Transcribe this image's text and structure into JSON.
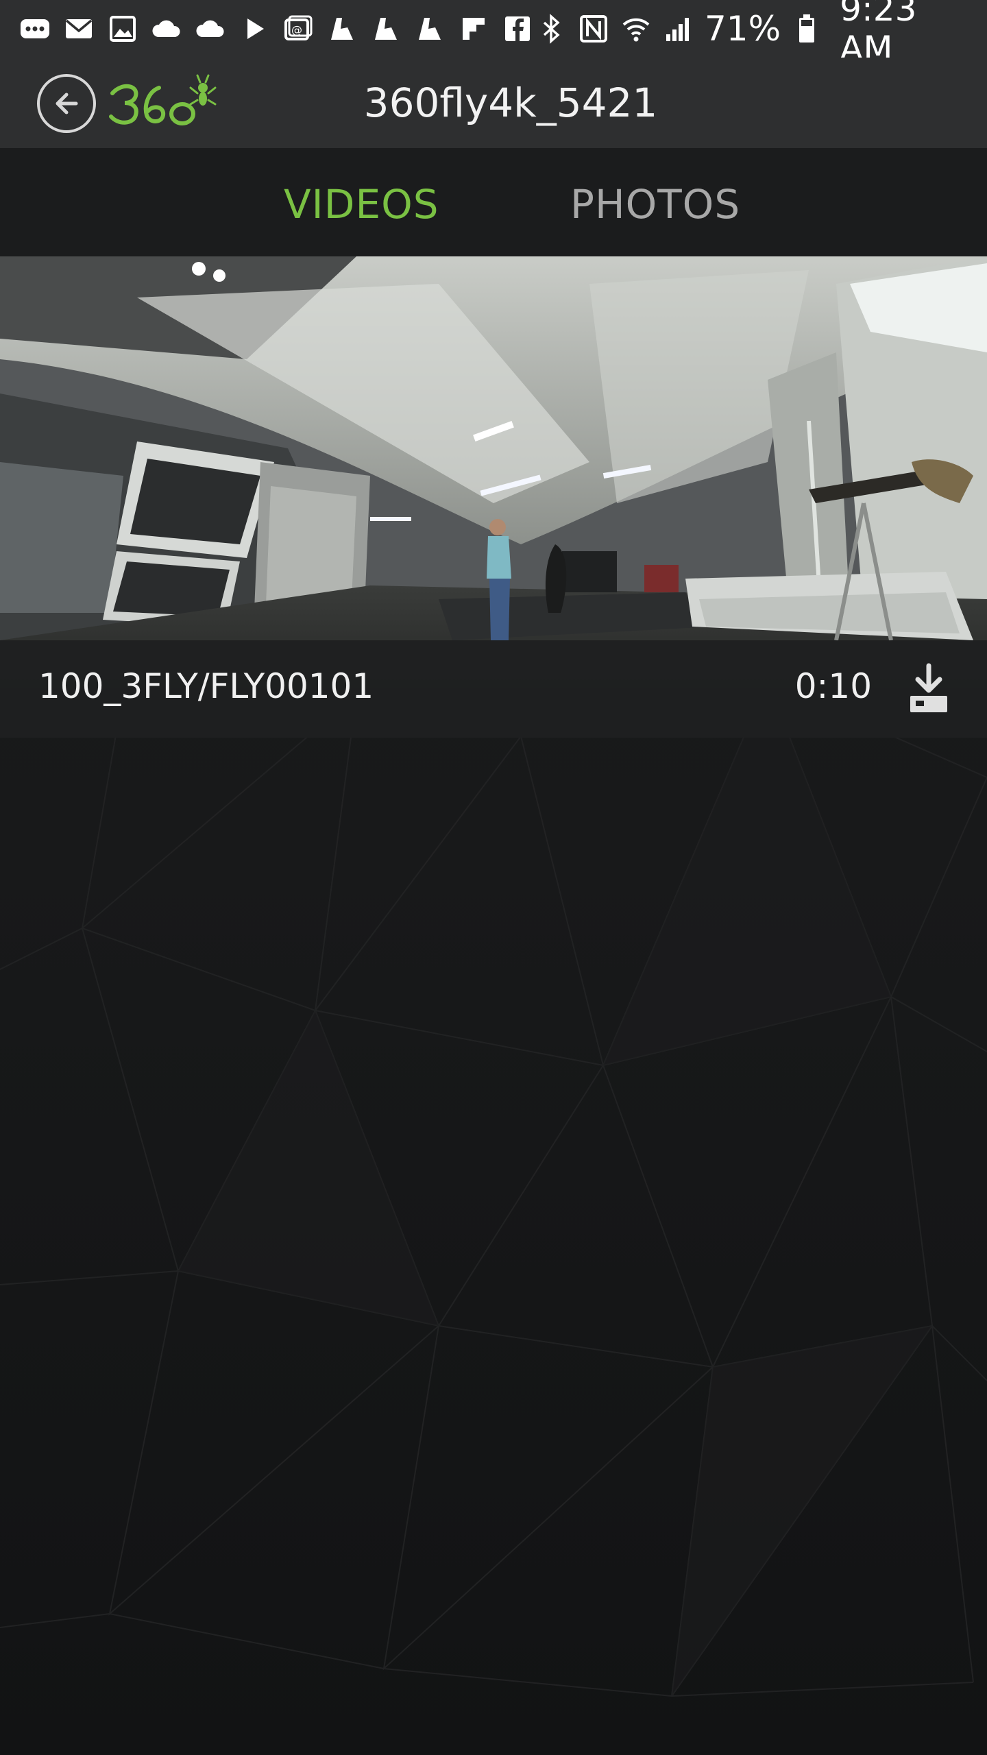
{
  "status_bar": {
    "left_icons": [
      "more-icon",
      "mail-icon",
      "gallery-icon",
      "cloud-icon",
      "cloud-icon",
      "play-store-icon",
      "hangouts-icon",
      "flipboard-icon",
      "flipboard-icon",
      "flipboard-icon",
      "flipboard-logo-icon",
      "facebook-icon"
    ],
    "right_icons": [
      "bluetooth-icon",
      "nfc-icon",
      "wifi-icon",
      "signal-icon",
      "battery-icon"
    ],
    "battery": "71%",
    "time": "9:23 AM"
  },
  "header": {
    "title": "360fly4k_5421",
    "back_icon": "back-arrow-icon",
    "logo_icon": "360fly-logo-icon"
  },
  "tabs": [
    {
      "label": "VIDEOS",
      "active": true
    },
    {
      "label": "PHOTOS",
      "active": false
    }
  ],
  "videos": [
    {
      "path": "100_3FLY/FLY00101",
      "duration": "0:10",
      "action_icon": "download-icon"
    }
  ],
  "colors": {
    "accent": "#7ac143",
    "header_bg": "#2e2f30",
    "tab_bg": "#1b1c1d",
    "inactive_tab": "#a8a8a8",
    "page_bg": "#151617"
  }
}
